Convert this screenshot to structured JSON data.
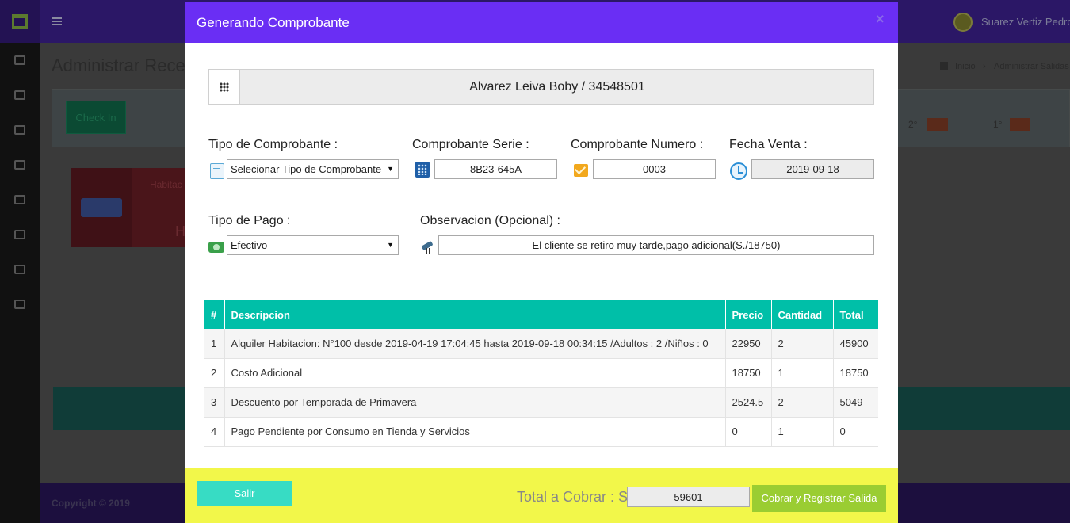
{
  "background": {
    "page_title": "Administrar Rece",
    "user_name": "Suarez Vertiz Pedro",
    "breadcrumb_home": "Inicio",
    "breadcrumb_current": "Administrar Salidas",
    "checkin_label": "Check In",
    "floor_2": "2°",
    "floor_1": "1°",
    "card_label": "Habitac",
    "card_letter": "H",
    "copyright": "Copyright © 2019"
  },
  "modal": {
    "title": "Generando Comprobante",
    "close": "×",
    "client": "Alvarez Leiva Boby / 34548501",
    "fields": {
      "tipo_comprobante": {
        "label": "Tipo de Comprobante :",
        "value": "Selecionar Tipo de Comprobante"
      },
      "serie": {
        "label": "Comprobante Serie :",
        "value": "8B23-645A"
      },
      "numero": {
        "label": "Comprobante Numero :",
        "value": "0003"
      },
      "fecha": {
        "label": "Fecha Venta :",
        "value": "2019-09-18"
      },
      "tipo_pago": {
        "label": "Tipo de Pago :",
        "value": "Efectivo"
      },
      "observacion": {
        "label": "Observacion (Opcional) :",
        "value": "El cliente se retiro muy tarde,pago adicional(S./18750)"
      }
    },
    "table": {
      "headers": [
        "#",
        "Descripcion",
        "Precio",
        "Cantidad",
        "Total"
      ],
      "rows": [
        [
          "1",
          "Alquiler Habitacion: N°100 desde 2019-04-19 17:04:45 hasta 2019-09-18 00:34:15 /Adultos : 2 /Niños : 0",
          "22950",
          "2",
          "45900"
        ],
        [
          "2",
          "Costo Adicional",
          "18750",
          "1",
          "18750"
        ],
        [
          "3",
          "Descuento por Temporada de Primavera",
          "2524.5",
          "2",
          "5049"
        ],
        [
          "4",
          "Pago Pendiente por Consumo en Tienda y Servicios",
          "0",
          "1",
          "0"
        ]
      ]
    },
    "footer": {
      "salir": "Salir",
      "total_label": "Total a Cobrar : S/.",
      "total_value": "59601",
      "cobrar": "Cobrar y Registrar Salida"
    }
  },
  "colors": {
    "modal_header": "#6a2ef4",
    "table_header": "#00bfa8",
    "footer_bg": "#f2f74a",
    "salir_button": "#37dcc4",
    "cobrar_button": "#9acd32"
  }
}
